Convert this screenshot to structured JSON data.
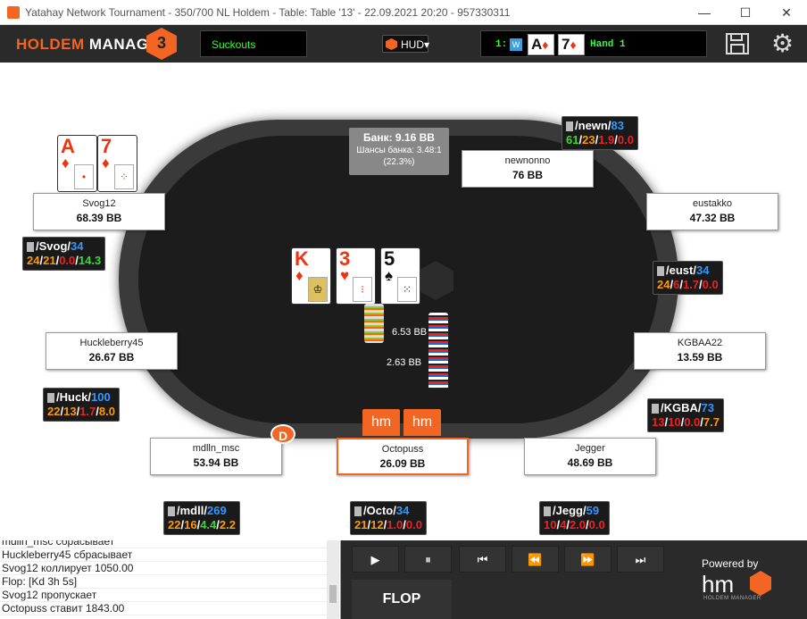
{
  "window": {
    "title": "Yatahay Network Tournament - 350/700 NL Holdem - Table: Table '13' - 22.09.2021 20:20 - 957330311",
    "minimize": "—",
    "maximize": "☐",
    "close": "✕"
  },
  "toolbar": {
    "logo_text": "HOLDEM",
    "logo_text2": " MANAGER",
    "logo_num": "3",
    "suckouts": "Suckouts",
    "hud": "HUD▾",
    "hand_number": "1:",
    "hand_card1_rank": "A",
    "hand_card1_suit": "♦",
    "hand_card2_rank": "7",
    "hand_card2_suit": "♦",
    "hand_label": "Hand 1"
  },
  "pot": {
    "title": "Банк: 9.16 BB",
    "odds": "Шансы банка: 3.48:1",
    "pct": "(22.3%)"
  },
  "board": [
    {
      "rank": "K",
      "suit": "♦",
      "color": "#e31"
    },
    {
      "rank": "3",
      "suit": "♥",
      "color": "#e31"
    },
    {
      "rank": "5",
      "suit": "♠",
      "color": "#111"
    }
  ],
  "hero_cards": [
    {
      "rank": "A",
      "suit": "♦"
    },
    {
      "rank": "7",
      "suit": "♦"
    }
  ],
  "seats": {
    "newnonno": {
      "name": "newnonno",
      "stack": "76 BB"
    },
    "svog": {
      "name": "Svog12",
      "stack": "68.39 BB"
    },
    "eust": {
      "name": "eustakko",
      "stack": "47.32 BB"
    },
    "huck": {
      "name": "Huckleberry45",
      "stack": "26.67 BB"
    },
    "kgba": {
      "name": "KGBAA22",
      "stack": "13.59 BB"
    },
    "mdll": {
      "name": "mdlln_msc",
      "stack": "53.94 BB"
    },
    "octo": {
      "name": "Octopuss",
      "stack": "26.09 BB"
    },
    "jegg": {
      "name": "Jegger",
      "stack": "48.69 BB"
    }
  },
  "huds": {
    "newn": {
      "name": "newn",
      "hands": "83",
      "s1": "61",
      "s2": "23",
      "s3": "1.9",
      "s4": "0.0"
    },
    "svog": {
      "name": "Svog",
      "hands": "34",
      "s1": "24",
      "s2": "21",
      "s3": "0.0",
      "s4": "14.3"
    },
    "eust": {
      "name": "eust",
      "hands": "34",
      "s1": "24",
      "s2": "6",
      "s3": "1.7",
      "s4": "0.0"
    },
    "huck": {
      "name": "Huck",
      "hands": "100",
      "s1": "22",
      "s2": "13",
      "s3": "1.7",
      "s4": "8.0"
    },
    "kgba": {
      "name": "KGBA",
      "hands": "73",
      "s1": "13",
      "s2": "10",
      "s3": "0.0",
      "s4": "7.7"
    },
    "mdll": {
      "name": "mdll",
      "hands": "269",
      "s1": "22",
      "s2": "16",
      "s3": "4.4",
      "s4": "2.2"
    },
    "octo": {
      "name": "Octo",
      "hands": "34",
      "s1": "21",
      "s2": "12",
      "s3": "1.0",
      "s4": "0.0"
    },
    "jegg": {
      "name": "Jegg",
      "hands": "59",
      "s1": "10",
      "s2": "4",
      "s3": "2.0",
      "s4": "0.0"
    },
    "sep": "/"
  },
  "bets": {
    "bet1": "6.53 BB",
    "bet2": "2.63 BB"
  },
  "dealer": "D",
  "hm_button": "hm",
  "log": [
    "mdlln_msc сбрасывает",
    "Huckleberry45 сбрасывает",
    "Svog12 коллирует 1050.00",
    "Flop: [Kd 3h 5s]",
    "Svog12 пропускает",
    "Octopuss ставит 1843.00"
  ],
  "controls": {
    "play": "▶",
    "pause": "⏸",
    "first": "⏮",
    "rewind": "⏪",
    "forward": "⏩",
    "last": "⏭",
    "street": "FLOP"
  },
  "branding": {
    "powered_by": "Powered by",
    "hm": "hm",
    "sub": "HOLDEM MANAGER"
  }
}
